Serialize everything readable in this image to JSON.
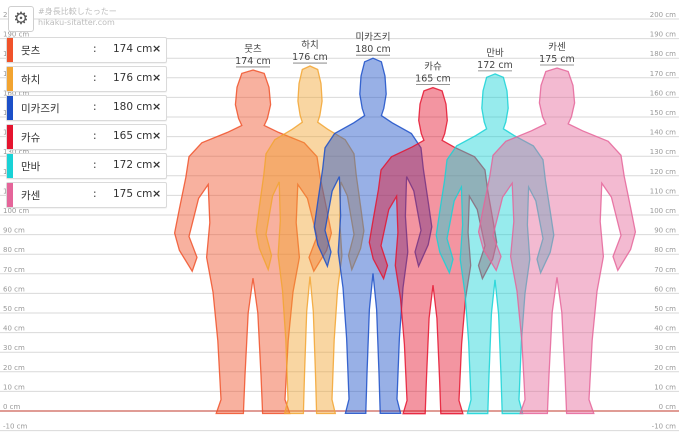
{
  "app": {
    "title": "#身長比較したったー",
    "url": "hikaku-sitatter.com",
    "settings_icon": "gear-icon"
  },
  "scale": {
    "unit": "cm",
    "min": -10,
    "max": 200,
    "step": 10,
    "labels": [
      "-10 cm",
      "0 cm",
      "10 cm",
      "20 cm",
      "30 cm",
      "40 cm",
      "50 cm",
      "60 cm",
      "70 cm",
      "80 cm",
      "90 cm",
      "100 cm",
      "110 cm",
      "120 cm",
      "130 cm",
      "140 cm",
      "150 cm",
      "160 cm",
      "170 cm",
      "180 cm",
      "190 cm",
      "200 cm"
    ],
    "zero_line_color": "#c0392b"
  },
  "people": [
    {
      "name": "뭇츠",
      "height": 174,
      "height_label": "174 cm",
      "color": "#F0522A",
      "remove_icon": "close-icon"
    },
    {
      "name": "하치",
      "height": 176,
      "height_label": "176 cm",
      "color": "#F2A431",
      "remove_icon": "close-icon"
    },
    {
      "name": "미카즈키",
      "height": 180,
      "height_label": "180 cm",
      "color": "#1B4FC8",
      "remove_icon": "close-icon"
    },
    {
      "name": "카슈",
      "height": 165,
      "height_label": "165 cm",
      "color": "#E5142F",
      "remove_icon": "close-icon"
    },
    {
      "name": "만바",
      "height": 172,
      "height_label": "172 cm",
      "color": "#18D2D6",
      "remove_icon": "close-icon"
    },
    {
      "name": "카센",
      "height": 175,
      "height_label": "175 cm",
      "color": "#E5659A",
      "remove_icon": "close-icon"
    }
  ],
  "panel_separator": ":",
  "remove_glyph": "×"
}
